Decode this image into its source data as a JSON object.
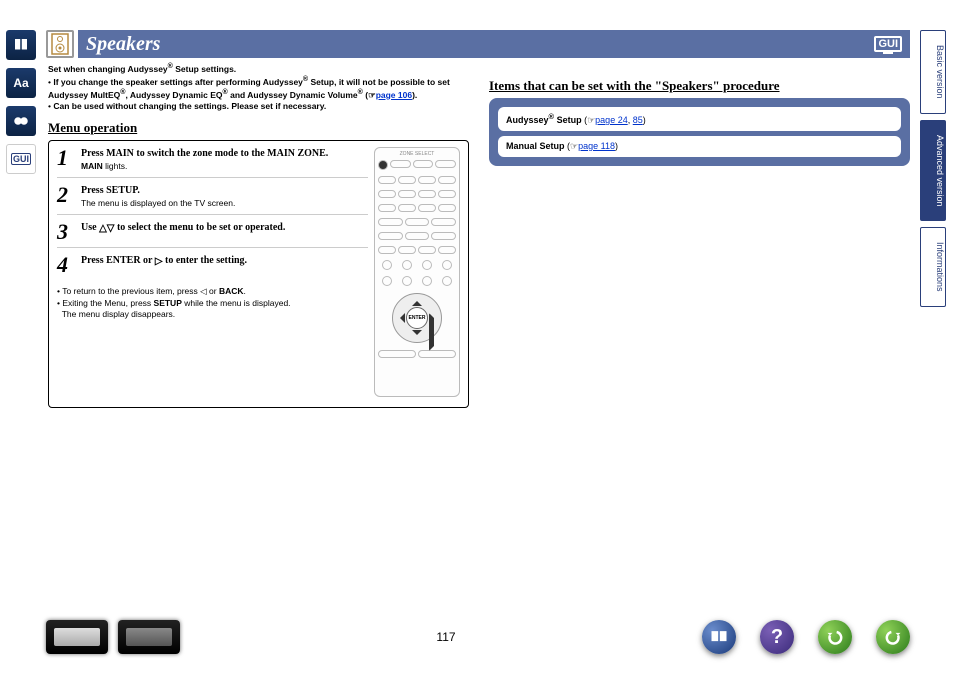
{
  "header": {
    "title": "Speakers",
    "badge": "GUI"
  },
  "notes": {
    "line1_a": "Set when changing Audyssey",
    "line1_b": " Setup settings.",
    "bullet1_a": "If you change the speaker settings after performing Audyssey",
    "bullet1_b": " Setup, it will not be possible to set Audyssey MultEQ",
    "bullet1_c": ", Audyssey Dynamic EQ",
    "bullet1_d": " and Audyssey Dynamic Volume",
    "bullet1_e": " (",
    "bullet1_link": "page  106",
    "bullet1_f": ").",
    "bullet2": "Can be used without changing the settings. Please set if necessary."
  },
  "menu_title": "Menu operation",
  "steps": [
    {
      "n": "1",
      "a": "Press ",
      "b": "MAIN",
      "c": " to switch the zone mode to the MAIN ZONE.",
      "sub_a": "MAIN",
      "sub_b": " lights."
    },
    {
      "n": "2",
      "a": "Press ",
      "b": "SETUP",
      "c": ".",
      "sub": "The menu is displayed on the TV screen."
    },
    {
      "n": "3",
      "a": "Use ",
      "tri": "△▽",
      "c": " to select the menu to be set or operated."
    },
    {
      "n": "4",
      "a": "Press ",
      "b": "ENTER",
      "c": " or ",
      "tri2": "▷",
      "d": " to enter the setting."
    }
  ],
  "panel_notes": {
    "a": "To return to the previous item, press ◁ or ",
    "b": "BACK",
    "c": ".",
    "d": "Exiting the Menu, press ",
    "e": "SETUP",
    "f": " while the menu is displayed.",
    "g": "The menu display disappears."
  },
  "remote": {
    "title": "ZONE SELECT",
    "enter": "ENTER"
  },
  "items_title": "Items that can be set with the \"Speakers\" procedure",
  "items": [
    {
      "label_a": "Audyssey",
      "label_b": " Setup",
      "pg_a": " (",
      "link1": "page 24",
      "sep": ", ",
      "link2": "85",
      "pg_b": ")"
    },
    {
      "label": "Manual Setup",
      "pg_a": " (",
      "link1": "page 118",
      "pg_b": ")"
    }
  ],
  "tabs": {
    "basic": "Basic version",
    "advanced": "Advanced version",
    "info": "Informations"
  },
  "page_num": "117",
  "help_glyph": "?"
}
